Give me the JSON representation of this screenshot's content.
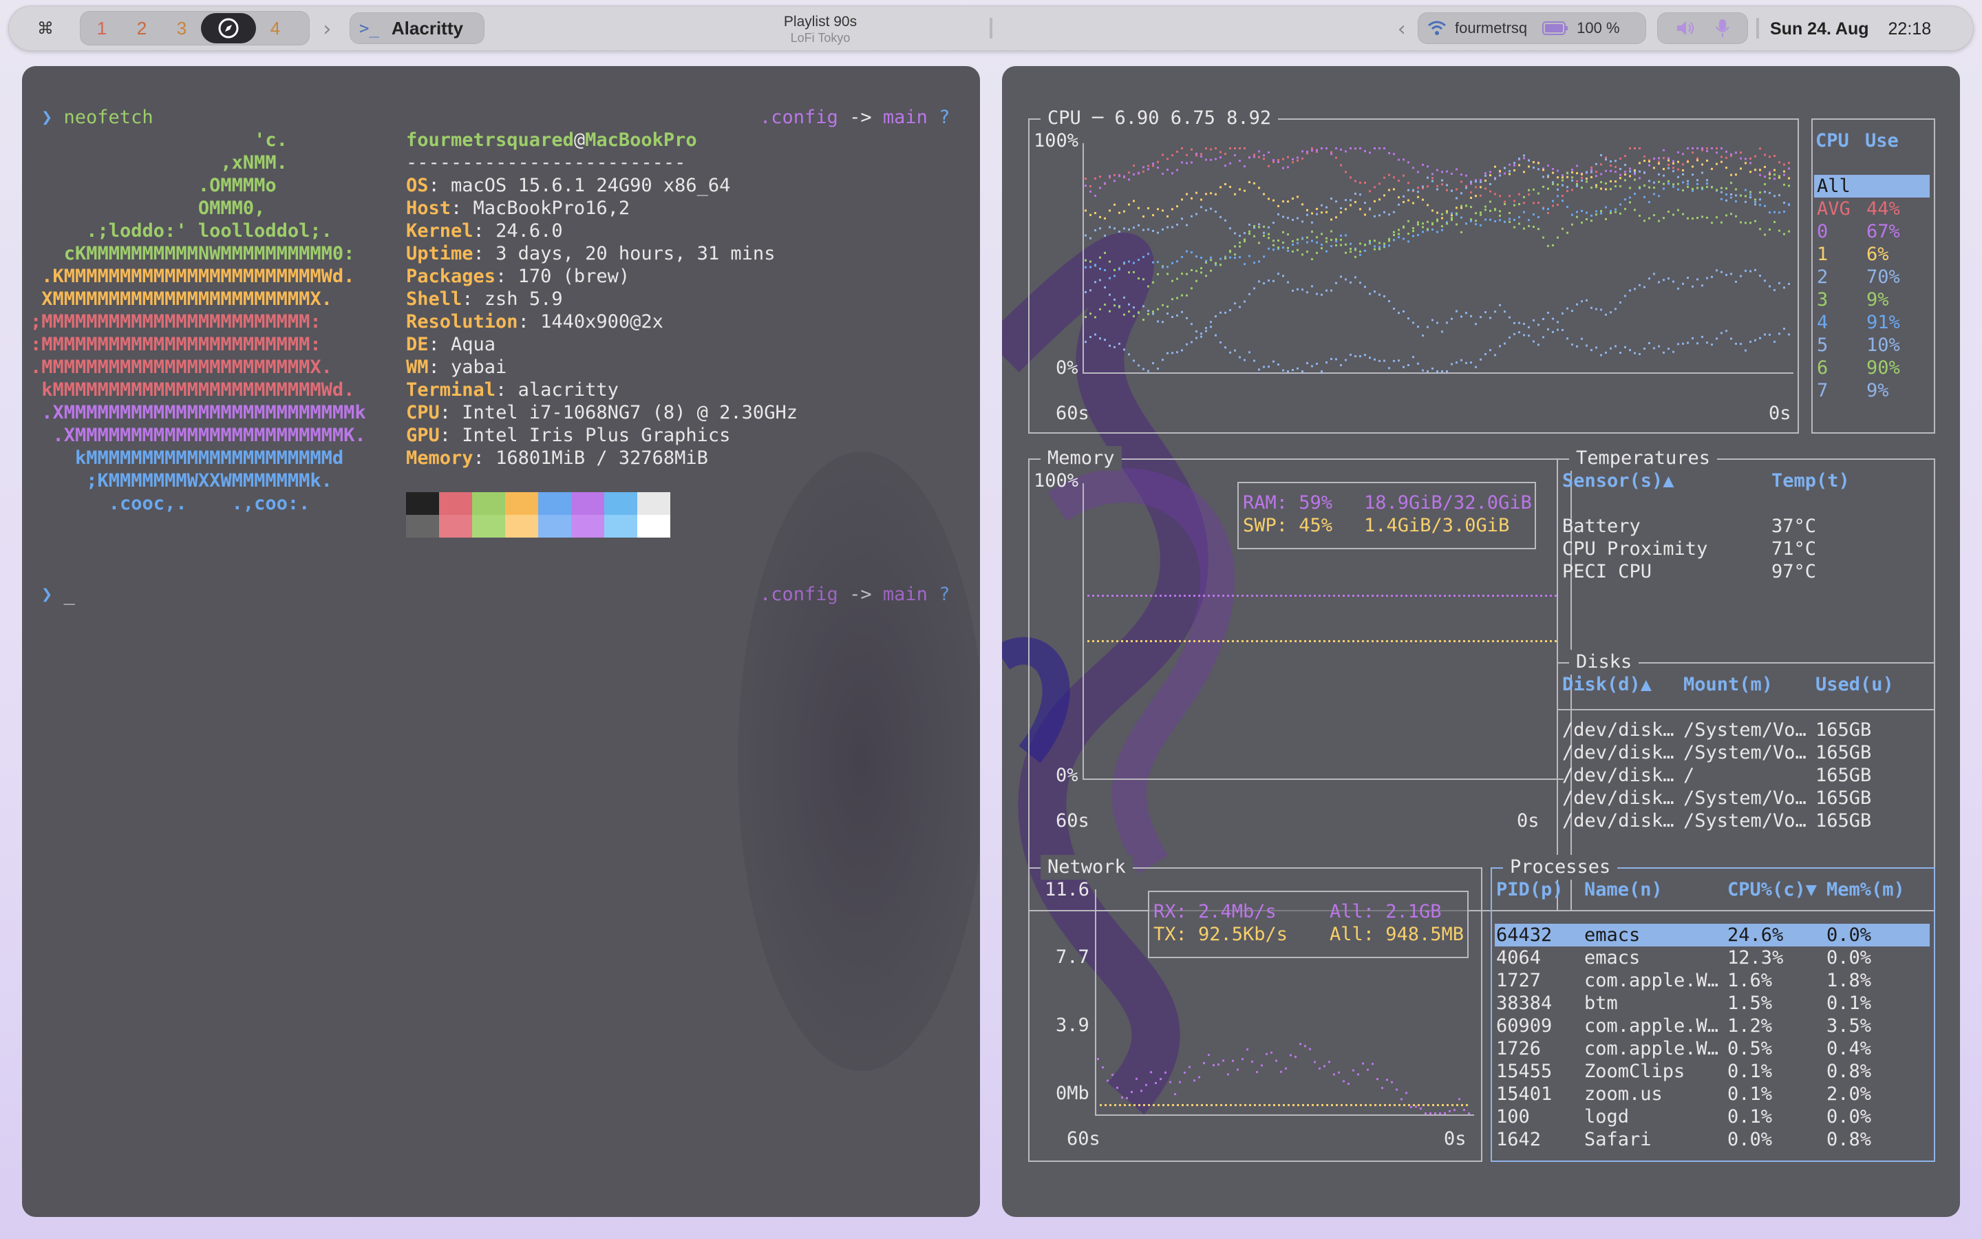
{
  "topbar": {
    "cmd_icon": "command-icon",
    "workspaces": [
      "1",
      "2",
      "3",
      "4"
    ],
    "active_workspace_icon": "compass-icon",
    "app_name": "Alacritty",
    "now_playing": {
      "title": "Playlist 90s",
      "subtitle": "LoFi Tokyo"
    },
    "wifi_name": "fourmetrsq",
    "battery": "100 %",
    "date": "Sun 24. Aug",
    "time": "22:18"
  },
  "terminal": {
    "prompt_symbol": "❯",
    "command": "neofetch",
    "cursor": "_",
    "right_prompt_dir": ".config",
    "right_prompt_arrow": "->",
    "right_prompt_branch": "main",
    "right_prompt_status": "?",
    "ascii_art": [
      {
        "text": "                    'c.",
        "color": "#9ece6a"
      },
      {
        "text": "                 ,xNMM.",
        "color": "#9ece6a"
      },
      {
        "text": "               .OMMMMo",
        "color": "#9ece6a"
      },
      {
        "text": "               OMMM0,",
        "color": "#9ece6a"
      },
      {
        "text": "     .;loddo:' loolloddol;.",
        "color": "#9ece6a"
      },
      {
        "text": "   cKMMMMMMMMMMNWMMMMMMMMMM0:",
        "color": "#9ece6a"
      },
      {
        "text": " .KMMMMMMMMMMMMMMMMMMMMMMMWd.",
        "color": "#f7b955"
      },
      {
        "text": " XMMMMMMMMMMMMMMMMMMMMMMMX.",
        "color": "#f7b955"
      },
      {
        "text": ";MMMMMMMMMMMMMMMMMMMMMMMM:",
        "color": "#e06c75"
      },
      {
        "text": ":MMMMMMMMMMMMMMMMMMMMMMMM:",
        "color": "#e06c75"
      },
      {
        "text": ".MMMMMMMMMMMMMMMMMMMMMMMMX.",
        "color": "#e06c75"
      },
      {
        "text": " kMMMMMMMMMMMMMMMMMMMMMMMMWd.",
        "color": "#e06c75"
      },
      {
        "text": " .XMMMMMMMMMMMMMMMMMMMMMMMMMMk",
        "color": "#bb77e8"
      },
      {
        "text": "  .XMMMMMMMMMMMMMMMMMMMMMMMMK.",
        "color": "#bb77e8"
      },
      {
        "text": "    kMMMMMMMMMMMMMMMMMMMMMMd",
        "color": "#6aa8f0"
      },
      {
        "text": "     ;KMMMMMMMWXXWMMMMMMMk.",
        "color": "#6aa8f0"
      },
      {
        "text": "       .cooc,.    .,coo:.",
        "color": "#6aa8f0"
      }
    ],
    "user": "fourmetrsquared",
    "at": "@",
    "host": "MacBookPro",
    "separator": "-------------------------",
    "info": [
      {
        "key": "OS",
        "value": "macOS 15.6.1 24G90 x86_64"
      },
      {
        "key": "Host",
        "value": "MacBookPro16,2"
      },
      {
        "key": "Kernel",
        "value": "24.6.0"
      },
      {
        "key": "Uptime",
        "value": "3 days, 20 hours, 31 mins"
      },
      {
        "key": "Packages",
        "value": "170 (brew)"
      },
      {
        "key": "Shell",
        "value": "zsh 5.9"
      },
      {
        "key": "Resolution",
        "value": "1440x900@2x"
      },
      {
        "key": "DE",
        "value": "Aqua"
      },
      {
        "key": "WM",
        "value": "yabai"
      },
      {
        "key": "Terminal",
        "value": "alacritty"
      },
      {
        "key": "CPU",
        "value": "Intel i7-1068NG7 (8) @ 2.30GHz"
      },
      {
        "key": "GPU",
        "value": "Intel Iris Plus Graphics"
      },
      {
        "key": "Memory",
        "value": "16801MiB / 32768MiB"
      }
    ],
    "palette_top": [
      "#222222",
      "#e06c75",
      "#9ece6a",
      "#f7b955",
      "#6aa8f0",
      "#bb77e8",
      "#6ab8f0",
      "#e8e8e8"
    ],
    "palette_bottom": [
      "#666666",
      "#e67c85",
      "#a8d878",
      "#fccf82",
      "#86b8f5",
      "#c88af0",
      "#8ccef8",
      "#ffffff"
    ]
  },
  "btm": {
    "cpu": {
      "title": "CPU ─ 6.90 6.75 8.92",
      "y_top": "100%",
      "y_bottom": "0%",
      "x_left": "60s",
      "x_right": "0s",
      "col_cpu": "CPU",
      "col_use": "Use",
      "rows": [
        {
          "label": "All",
          "use": "",
          "color": "#1a1a1a"
        },
        {
          "label": "AVG",
          "use": "44%",
          "color": "#e06c75"
        },
        {
          "label": "0",
          "use": "67%",
          "color": "#bb77e8"
        },
        {
          "label": "1",
          "use": "6%",
          "color": "#f7d06b"
        },
        {
          "label": "2",
          "use": "70%",
          "color": "#8fb4e8"
        },
        {
          "label": "3",
          "use": "9%",
          "color": "#9ece6a"
        },
        {
          "label": "4",
          "use": "91%",
          "color": "#6aa8f0"
        },
        {
          "label": "5",
          "use": "10%",
          "color": "#8fb4e8"
        },
        {
          "label": "6",
          "use": "90%",
          "color": "#9ece6a"
        },
        {
          "label": "7",
          "use": "9%",
          "color": "#8fb4e8"
        }
      ]
    },
    "memory": {
      "title": "Memory",
      "y_top": "100%",
      "y_bottom": "0%",
      "x_left": "60s",
      "x_right": "0s",
      "ram_label": "RAM: 59%",
      "ram_value": "18.9GiB/32.0GiB",
      "swp_label": "SWP: 45%",
      "swp_value": "1.4GiB/3.0GiB"
    },
    "temps": {
      "title": "Temperatures",
      "col_sensor": "Sensor(s)▲",
      "col_temp": "Temp(t)",
      "rows": [
        {
          "name": "Battery",
          "temp": "37°C"
        },
        {
          "name": "CPU Proximity",
          "temp": "71°C"
        },
        {
          "name": "PECI CPU",
          "temp": "97°C"
        }
      ]
    },
    "disks": {
      "title": "Disks",
      "col_disk": "Disk(d)▲",
      "col_mount": "Mount(m)",
      "col_used": "Used(u)",
      "rows": [
        {
          "disk": "/dev/disk…",
          "mount": "/System/Vo…",
          "used": "165GB"
        },
        {
          "disk": "/dev/disk…",
          "mount": "/System/Vo…",
          "used": "165GB"
        },
        {
          "disk": "/dev/disk…",
          "mount": "/",
          "used": "165GB"
        },
        {
          "disk": "/dev/disk…",
          "mount": "/System/Vo…",
          "used": "165GB"
        },
        {
          "disk": "/dev/disk…",
          "mount": "/System/Vo…",
          "used": "165GB"
        }
      ]
    },
    "network": {
      "title": "Network",
      "y_labels": [
        "11.6",
        "7.7",
        "3.9",
        "0Mb"
      ],
      "x_left": "60s",
      "x_right": "0s",
      "rx": "RX: 2.4Mb/s",
      "rx_all": "All: 2.1GB",
      "tx": "TX: 92.5Kb/s",
      "tx_all": "All: 948.5MB"
    },
    "processes": {
      "title": "Processes",
      "col_pid": "PID(p)",
      "col_name": "Name(n)",
      "col_cpu": "CPU%(c)▼",
      "col_mem": "Mem%(m)",
      "rows": [
        {
          "pid": "64432",
          "name": "emacs",
          "cpu": "24.6%",
          "mem": "0.0%"
        },
        {
          "pid": "4064",
          "name": "emacs",
          "cpu": "12.3%",
          "mem": "0.0%"
        },
        {
          "pid": "1727",
          "name": "com.apple.W…",
          "cpu": "1.6%",
          "mem": "1.8%"
        },
        {
          "pid": "38384",
          "name": "btm",
          "cpu": "1.5%",
          "mem": "0.1%"
        },
        {
          "pid": "60909",
          "name": "com.apple.W…",
          "cpu": "1.2%",
          "mem": "3.5%"
        },
        {
          "pid": "1726",
          "name": "com.apple.W…",
          "cpu": "0.5%",
          "mem": "0.4%"
        },
        {
          "pid": "15455",
          "name": "ZoomClips",
          "cpu": "0.1%",
          "mem": "0.8%"
        },
        {
          "pid": "15401",
          "name": "zoom.us",
          "cpu": "0.1%",
          "mem": "2.0%"
        },
        {
          "pid": "100",
          "name": "logd",
          "cpu": "0.1%",
          "mem": "0.0%"
        },
        {
          "pid": "1642",
          "name": "Safari",
          "cpu": "0.0%",
          "mem": "0.8%"
        }
      ]
    }
  }
}
